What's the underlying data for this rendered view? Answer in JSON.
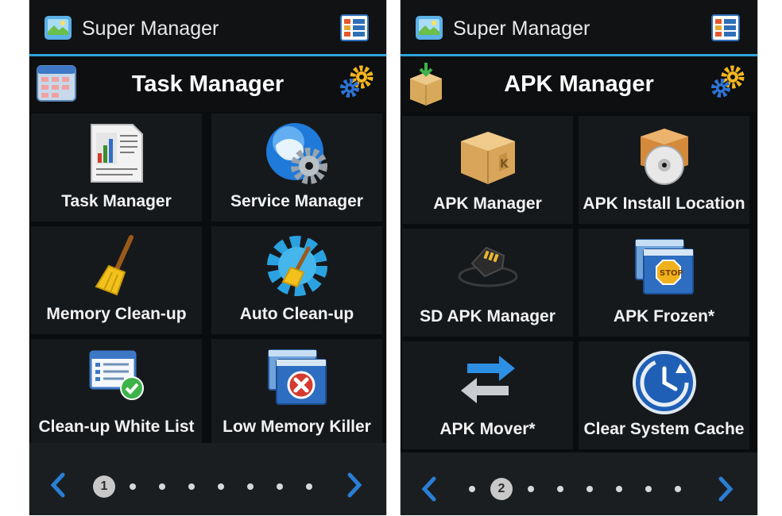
{
  "screens": [
    {
      "app_title": "Super Manager",
      "header_title": "Task Manager",
      "tiles": [
        {
          "label": "Task Manager",
          "icon": "report-document-icon"
        },
        {
          "label": "Service Manager",
          "icon": "globe-gear-icon"
        },
        {
          "label": "Memory Clean-up",
          "icon": "broom-icon"
        },
        {
          "label": "Auto Clean-up",
          "icon": "gear-broom-icon"
        },
        {
          "label": "Clean-up White List",
          "icon": "list-check-icon"
        },
        {
          "label": "Low Memory Killer",
          "icon": "windows-close-icon"
        }
      ],
      "current_page": "1",
      "page_count": 8
    },
    {
      "app_title": "Super Manager",
      "header_title": "APK Manager",
      "tiles": [
        {
          "label": "APK Manager",
          "icon": "package-box-icon"
        },
        {
          "label": "APK Install Location",
          "icon": "box-disc-icon"
        },
        {
          "label": "SD APK Manager",
          "icon": "sd-card-icon"
        },
        {
          "label": "APK Frozen*",
          "icon": "windows-stop-icon"
        },
        {
          "label": "APK Mover*",
          "icon": "swap-arrows-icon"
        },
        {
          "label": "Clear System Cache",
          "icon": "clock-refresh-icon"
        }
      ],
      "current_page": "2",
      "page_count": 8
    }
  ],
  "colors": {
    "accent": "#2fa3d9",
    "background": "#0a0c0e",
    "tile": "#16191c",
    "pager": "#1b1e21",
    "arrow": "#2a7fd4"
  }
}
